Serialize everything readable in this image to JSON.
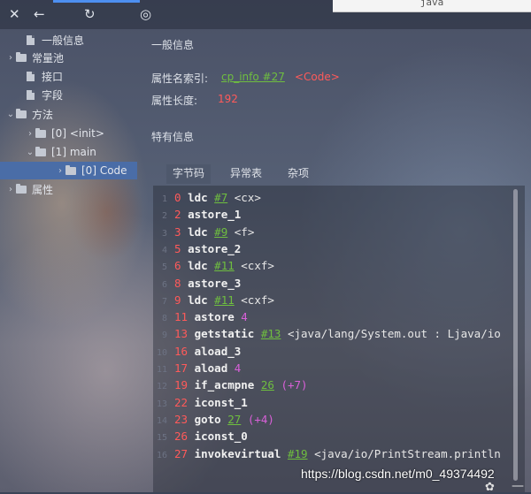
{
  "toolbar": {
    "close": "✕",
    "back": "←",
    "refresh": "↻",
    "globe": "◎",
    "tab_title": "java"
  },
  "tree": [
    {
      "label": "一般信息",
      "chev": "",
      "icon": "file"
    },
    {
      "label": "常量池",
      "chev": "›",
      "icon": "folder"
    },
    {
      "label": "接口",
      "chev": "",
      "icon": "file"
    },
    {
      "label": "字段",
      "chev": "",
      "icon": "file"
    },
    {
      "label": "方法",
      "chev": "⌄",
      "icon": "folder"
    },
    {
      "label": "[0] <init>",
      "chev": "›",
      "icon": "folder"
    },
    {
      "label": "[1] main",
      "chev": "⌄",
      "icon": "folder"
    },
    {
      "label": "[0] Code",
      "chev": "›",
      "icon": "folder"
    },
    {
      "label": "属性",
      "chev": "›",
      "icon": "folder"
    }
  ],
  "info": {
    "general_title": "一般信息",
    "name_index_label": "属性名索引:",
    "name_index_ref": "cp_info #27",
    "name_index_value": "<Code>",
    "length_label": "属性长度:",
    "length_value": "192",
    "specific_title": "特有信息"
  },
  "tabs": [
    "字节码",
    "异常表",
    "杂项"
  ],
  "code": [
    {
      "ln": "1",
      "off": "0",
      "op": "ldc",
      "ref": "#7",
      "cmt": "<cx>"
    },
    {
      "ln": "2",
      "off": "2",
      "op": "astore_1"
    },
    {
      "ln": "3",
      "off": "3",
      "op": "ldc",
      "ref": "#9",
      "cmt": "<f>"
    },
    {
      "ln": "4",
      "off": "5",
      "op": "astore_2"
    },
    {
      "ln": "5",
      "off": "6",
      "op": "ldc",
      "ref": "#11",
      "cmt": "<cxf>"
    },
    {
      "ln": "6",
      "off": "8",
      "op": "astore_3"
    },
    {
      "ln": "7",
      "off": "9",
      "op": "ldc",
      "ref": "#11",
      "cmt": "<cxf>"
    },
    {
      "ln": "8",
      "off": "11",
      "op": "astore",
      "num": "4"
    },
    {
      "ln": "9",
      "off": "13",
      "op": "getstatic",
      "ref": "#13",
      "cmt": "<java/lang/System.out : Ljava/io"
    },
    {
      "ln": "10",
      "off": "16",
      "op": "aload_3"
    },
    {
      "ln": "11",
      "off": "17",
      "op": "aload",
      "num": "4"
    },
    {
      "ln": "12",
      "off": "19",
      "op": "if_acmpne",
      "ref": "26",
      "num": "(+7)"
    },
    {
      "ln": "13",
      "off": "22",
      "op": "iconst_1"
    },
    {
      "ln": "14",
      "off": "23",
      "op": "goto",
      "ref": "27",
      "num": "(+4)"
    },
    {
      "ln": "15",
      "off": "26",
      "op": "iconst_0"
    },
    {
      "ln": "16",
      "off": "27",
      "op": "invokevirtual",
      "ref": "#19",
      "cmt": "<java/io/PrintStream.println"
    }
  ],
  "watermark": "https://blog.csdn.net/m0_49374492",
  "colors": {
    "accent": "#4d8ff0",
    "selected": "#4a6da7",
    "red": "#ff5a5a",
    "green": "#6fbf3f",
    "magenta": "#d960d9"
  }
}
